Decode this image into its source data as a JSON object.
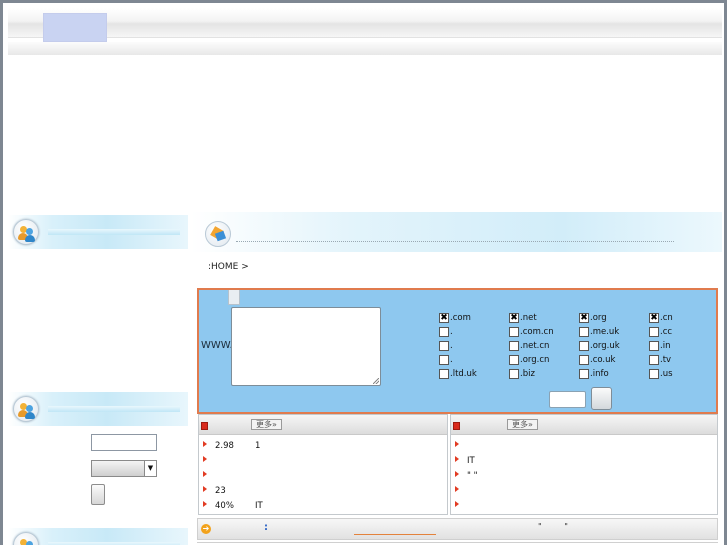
{
  "breadcrumb": ":HOME >",
  "domain_search": {
    "prefix": "WWW.",
    "tlds": [
      {
        "label": ".com",
        "checked": true
      },
      {
        "label": ".net",
        "checked": true
      },
      {
        "label": ".org",
        "checked": true
      },
      {
        "label": ".cn",
        "checked": true
      },
      {
        "label": ".",
        "checked": false
      },
      {
        "label": ".com.cn",
        "checked": false
      },
      {
        "label": ".me.uk",
        "checked": false
      },
      {
        "label": ".cc",
        "checked": false
      },
      {
        "label": ".",
        "checked": false
      },
      {
        "label": ".net.cn",
        "checked": false
      },
      {
        "label": ".org.uk",
        "checked": false
      },
      {
        "label": ".in",
        "checked": false
      },
      {
        "label": ".",
        "checked": false
      },
      {
        "label": ".org.cn",
        "checked": false
      },
      {
        "label": ".co.uk",
        "checked": false
      },
      {
        "label": ".tv",
        "checked": false
      },
      {
        "label": ".ltd.uk",
        "checked": false
      },
      {
        "label": ".biz",
        "checked": false
      },
      {
        "label": ".info",
        "checked": false
      },
      {
        "label": ".us",
        "checked": false
      }
    ]
  },
  "news_left": {
    "more_label": "更多»",
    "items": [
      {
        "a": "2.98",
        "b": "1"
      },
      {
        "a": "",
        "b": ""
      },
      {
        "a": "",
        "b": ""
      },
      {
        "a": "23",
        "b": ""
      },
      {
        "a": "40%",
        "b": "IT"
      }
    ]
  },
  "news_right": {
    "more_label": "更多»",
    "items": [
      {
        "a": "",
        "b": ""
      },
      {
        "a": "IT",
        "b": ""
      },
      {
        "a": "\" \"",
        "b": ""
      },
      {
        "a": "",
        "b": ""
      },
      {
        "a": "",
        "b": ""
      }
    ]
  },
  "bottom_bar": {
    "colon": ":",
    "quotes": "\" \""
  },
  "colors": {
    "panel_bg": "#8ec8ef",
    "panel_border": "#e07b4e",
    "nav_active": "#c9d3f2",
    "bullet": "#e23b22"
  },
  "icons": {
    "side_header_icon": "users-icon",
    "main_header_icon": "pencil-icon",
    "news_header_icon": "red-square-icon",
    "bottom_icon": "arrow-right-icon",
    "select_arrow": "▼"
  }
}
